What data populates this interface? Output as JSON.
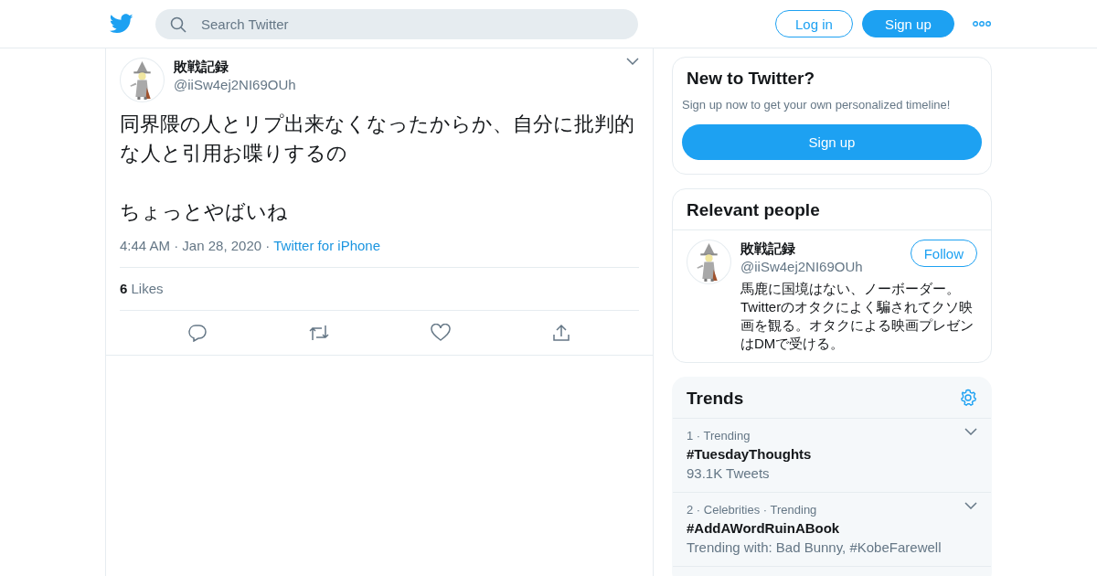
{
  "header": {
    "search": {
      "placeholder": "Search Twitter"
    },
    "buttons": [
      {
        "label": "Log in",
        "kind": "outline"
      },
      {
        "label": "Sign up",
        "kind": "filled"
      }
    ]
  },
  "tweet": {
    "name": "敗戦記録",
    "handle": "@iiSw4ej2NI69OUh",
    "paragraphs": [
      "同界隈の人とリプ出来なくなったからか、自分に批判的な人と引用お喋りするの",
      "ちょっとやばいね"
    ],
    "meta": "4:44 AM · Jan 28, 2020 ·",
    "source": "Twitter for iPhone",
    "likes_count": "6",
    "likes_label": "Likes"
  },
  "signup_card": {
    "title": "New to Twitter?",
    "text": "Sign up now to get your own personalized timeline!",
    "button": "Sign up"
  },
  "relevant_people": {
    "title": "Relevant people",
    "people": [
      {
        "name": "敗戦記録",
        "handle": "@iiSw4ej2NI69OUh",
        "button": "Follow",
        "bio": "馬鹿に国境はない、ノーボーダー。Twitterのオタクによく騙されてクソ映画を観る。オタクによる映画プレゼンはDMで受ける。"
      }
    ]
  },
  "trends": {
    "title": "Trends",
    "items": [
      {
        "meta": "1 · Trending",
        "tag": "#TuesdayThoughts",
        "detail": "93.1K Tweets"
      },
      {
        "meta": "2 · Celebrities · Trending",
        "tag": "#AddAWordRuinABook",
        "detail": "Trending with: Bad Bunny, #KobeFarewell"
      }
    ]
  }
}
